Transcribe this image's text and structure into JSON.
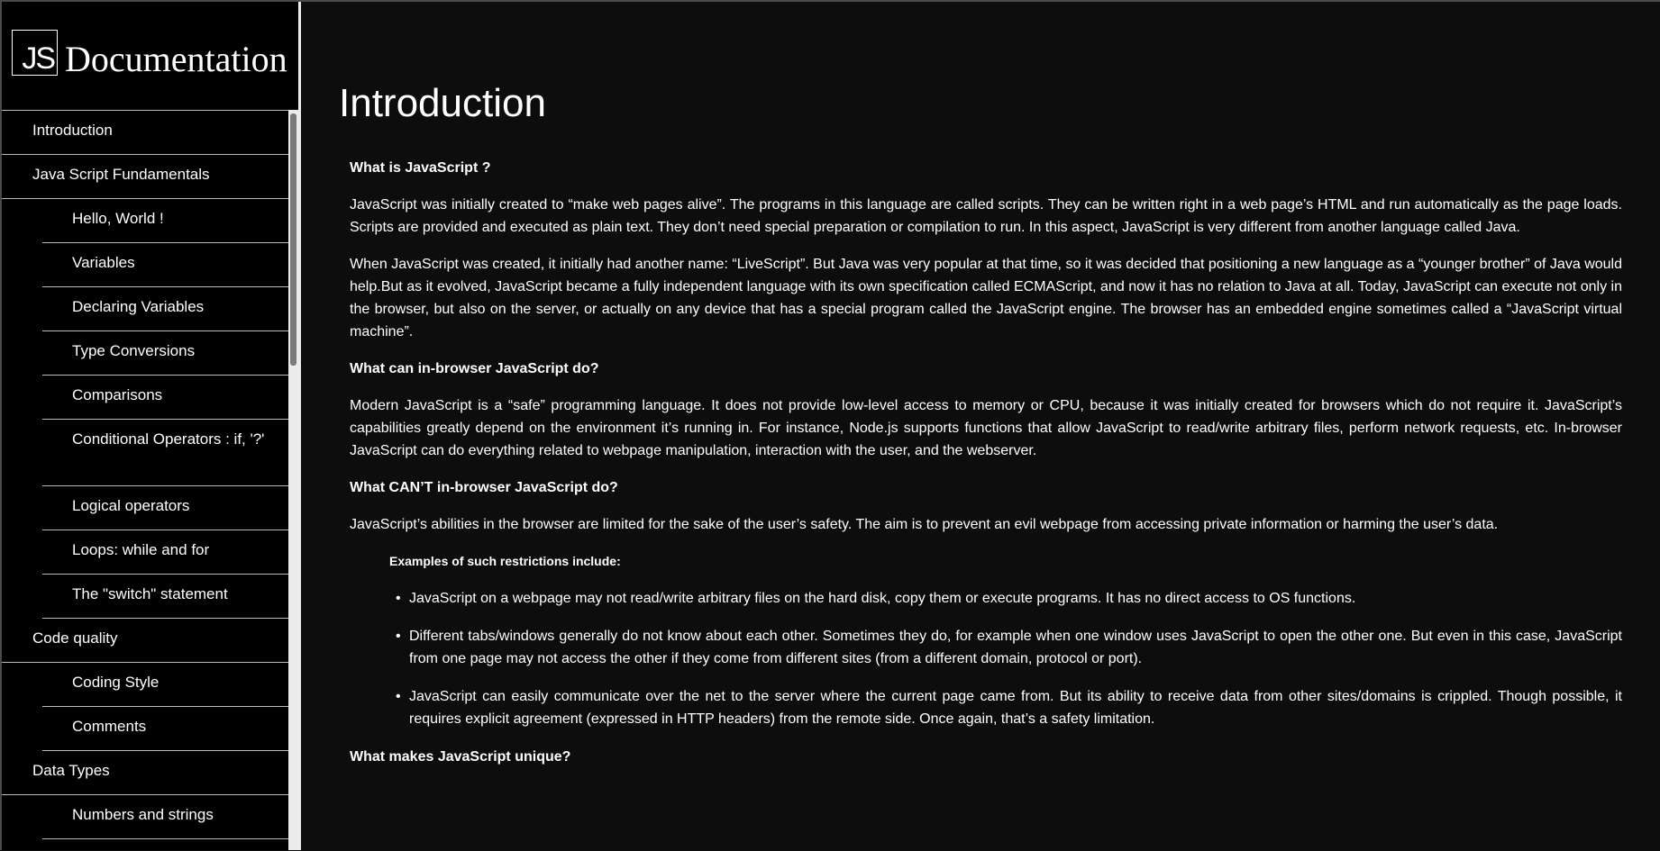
{
  "logo": {
    "mark": "JS",
    "title": "Documentation"
  },
  "nav": [
    {
      "label": "Introduction",
      "sub": false,
      "tall": false
    },
    {
      "label": "Java Script Fundamentals",
      "sub": false,
      "tall": false
    },
    {
      "label": "Hello, World !",
      "sub": true,
      "tall": false
    },
    {
      "label": "Variables",
      "sub": true,
      "tall": false
    },
    {
      "label": "Declaring Variables",
      "sub": true,
      "tall": false
    },
    {
      "label": "Type Conversions",
      "sub": true,
      "tall": false
    },
    {
      "label": "Comparisons",
      "sub": true,
      "tall": false
    },
    {
      "label": "Conditional Operators : if, '?'",
      "sub": true,
      "tall": true
    },
    {
      "label": "Logical operators",
      "sub": true,
      "tall": false
    },
    {
      "label": "Loops: while and for",
      "sub": true,
      "tall": false
    },
    {
      "label": "The \"switch\" statement",
      "sub": true,
      "tall": false
    },
    {
      "label": "Code quality",
      "sub": false,
      "tall": false
    },
    {
      "label": "Coding Style",
      "sub": true,
      "tall": false
    },
    {
      "label": "Comments",
      "sub": true,
      "tall": false
    },
    {
      "label": "Data Types",
      "sub": false,
      "tall": false
    },
    {
      "label": "Numbers and strings",
      "sub": true,
      "tall": false
    },
    {
      "label": "",
      "sub": true,
      "tall": false
    }
  ],
  "main": {
    "title": "Introduction",
    "blocks": [
      {
        "type": "h3",
        "name": "heading-what-is-js",
        "text": "What is JavaScript ?"
      },
      {
        "type": "p",
        "name": "paragraph-intro-1",
        "text": "JavaScript was initially created to “make web pages alive”. The programs in this language are called scripts. They can be written right in a web page’s HTML and run automatically as the page loads. Scripts are provided and executed as plain text. They don’t need special preparation or compilation to run. In this aspect, JavaScript is very different from another language called Java."
      },
      {
        "type": "p",
        "name": "paragraph-intro-2",
        "text": "When JavaScript was created, it initially had another name: “LiveScript”. But Java was very popular at that time, so it was decided that positioning a new language as a “younger brother” of Java would help.But as it evolved, JavaScript became a fully independent language with its own specification called ECMAScript, and now it has no relation to Java at all. Today, JavaScript can execute not only in the browser, but also on the server, or actually on any device that has a special program called the JavaScript engine. The browser has an embedded engine sometimes called a “JavaScript virtual machine”."
      },
      {
        "type": "h3",
        "name": "heading-can-do",
        "text": "What can in-browser JavaScript do?"
      },
      {
        "type": "p",
        "name": "paragraph-can-do",
        "text": "Modern JavaScript is a “safe” programming language. It does not provide low-level access to memory or CPU, because it was initially created for browsers which do not require it. JavaScript’s capabilities greatly depend on the environment it’s running in. For instance, Node.js supports functions that allow JavaScript to read/write arbitrary files, perform network requests, etc. In-browser JavaScript can do everything related to webpage manipulation, interaction with the user, and the webserver."
      },
      {
        "type": "h3",
        "name": "heading-cant-do",
        "text": "What CAN’T in-browser JavaScript do?"
      },
      {
        "type": "p",
        "name": "paragraph-cant-do",
        "text": "JavaScript’s abilities in the browser are limited for the sake of the user’s safety. The aim is to prevent an evil webpage from accessing private information or harming the user’s data."
      },
      {
        "type": "note",
        "name": "restrictions-note",
        "text": "Examples of such restrictions include:"
      },
      {
        "type": "ul",
        "name": "restrictions-list",
        "items": [
          "JavaScript on a webpage may not read/write arbitrary files on the hard disk, copy them or execute programs. It has no direct access to OS functions.",
          "Different tabs/windows generally do not know about each other. Sometimes they do, for example when one window uses JavaScript to open the other one. But even in this case, JavaScript from one page may not access the other if they come from different sites (from a different domain, protocol or port).",
          "JavaScript can easily communicate over the net to the server where the current page came from. But its ability to receive data from other sites/domains is crippled. Though possible, it requires explicit agreement (expressed in HTTP headers) from the remote side. Once again, that’s a safety limitation."
        ]
      },
      {
        "type": "h3",
        "name": "heading-unique",
        "text": "What makes JavaScript unique?"
      }
    ]
  },
  "ui": {
    "bullet": "•"
  }
}
